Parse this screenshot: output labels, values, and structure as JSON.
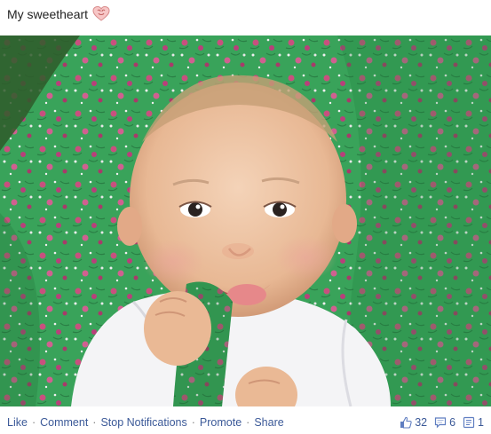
{
  "post": {
    "caption": "My sweetheart"
  },
  "photo": {
    "icon": "heart-emoji-icon"
  },
  "actions": {
    "like": "Like",
    "comment": "Comment",
    "stop_notifications": "Stop Notifications",
    "promote": "Promote",
    "share": "Share",
    "separator": "·"
  },
  "stats": {
    "likes": "32",
    "comments": "6",
    "shares": "1"
  },
  "colors": {
    "link": "#3b5998",
    "separator": "#7f7f7f"
  }
}
